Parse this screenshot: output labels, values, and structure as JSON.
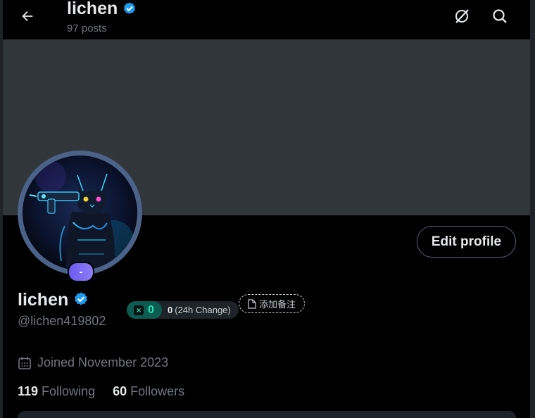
{
  "header": {
    "name": "lichen",
    "posts": "97 posts"
  },
  "avatar": {
    "pill_label": "-"
  },
  "actions": {
    "edit_profile": "Edit profile"
  },
  "profile": {
    "name": "lichen",
    "handle": "@lichen419802",
    "joined": "Joined November 2023"
  },
  "token": {
    "count": "0",
    "change_value": "0",
    "change_label": "(24h Change)"
  },
  "note": {
    "label": "添加备注"
  },
  "stats": {
    "following_count": "119",
    "following_label": "Following",
    "followers_count": "60",
    "followers_label": "Followers"
  },
  "colors": {
    "accent_blue": "#1d9bf0",
    "banner": "#31363b",
    "avatar_ring": "#4b6389",
    "token_green": "#2ee0b0"
  }
}
